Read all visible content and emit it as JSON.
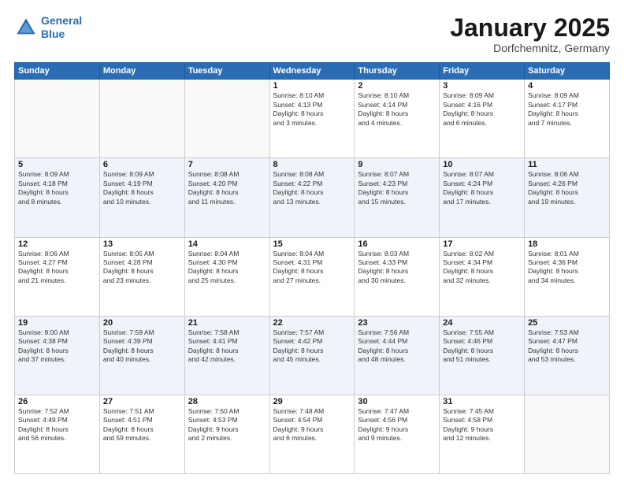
{
  "header": {
    "logo_line1": "General",
    "logo_line2": "Blue",
    "month": "January 2025",
    "location": "Dorfchemnitz, Germany"
  },
  "weekdays": [
    "Sunday",
    "Monday",
    "Tuesday",
    "Wednesday",
    "Thursday",
    "Friday",
    "Saturday"
  ],
  "weeks": [
    [
      {
        "day": "",
        "info": ""
      },
      {
        "day": "",
        "info": ""
      },
      {
        "day": "",
        "info": ""
      },
      {
        "day": "1",
        "info": "Sunrise: 8:10 AM\nSunset: 4:13 PM\nDaylight: 8 hours\nand 3 minutes."
      },
      {
        "day": "2",
        "info": "Sunrise: 8:10 AM\nSunset: 4:14 PM\nDaylight: 8 hours\nand 4 minutes."
      },
      {
        "day": "3",
        "info": "Sunrise: 8:09 AM\nSunset: 4:16 PM\nDaylight: 8 hours\nand 6 minutes."
      },
      {
        "day": "4",
        "info": "Sunrise: 8:09 AM\nSunset: 4:17 PM\nDaylight: 8 hours\nand 7 minutes."
      }
    ],
    [
      {
        "day": "5",
        "info": "Sunrise: 8:09 AM\nSunset: 4:18 PM\nDaylight: 8 hours\nand 8 minutes."
      },
      {
        "day": "6",
        "info": "Sunrise: 8:09 AM\nSunset: 4:19 PM\nDaylight: 8 hours\nand 10 minutes."
      },
      {
        "day": "7",
        "info": "Sunrise: 8:08 AM\nSunset: 4:20 PM\nDaylight: 8 hours\nand 11 minutes."
      },
      {
        "day": "8",
        "info": "Sunrise: 8:08 AM\nSunset: 4:22 PM\nDaylight: 8 hours\nand 13 minutes."
      },
      {
        "day": "9",
        "info": "Sunrise: 8:07 AM\nSunset: 4:23 PM\nDaylight: 8 hours\nand 15 minutes."
      },
      {
        "day": "10",
        "info": "Sunrise: 8:07 AM\nSunset: 4:24 PM\nDaylight: 8 hours\nand 17 minutes."
      },
      {
        "day": "11",
        "info": "Sunrise: 8:06 AM\nSunset: 4:26 PM\nDaylight: 8 hours\nand 19 minutes."
      }
    ],
    [
      {
        "day": "12",
        "info": "Sunrise: 8:06 AM\nSunset: 4:27 PM\nDaylight: 8 hours\nand 21 minutes."
      },
      {
        "day": "13",
        "info": "Sunrise: 8:05 AM\nSunset: 4:28 PM\nDaylight: 8 hours\nand 23 minutes."
      },
      {
        "day": "14",
        "info": "Sunrise: 8:04 AM\nSunset: 4:30 PM\nDaylight: 8 hours\nand 25 minutes."
      },
      {
        "day": "15",
        "info": "Sunrise: 8:04 AM\nSunset: 4:31 PM\nDaylight: 8 hours\nand 27 minutes."
      },
      {
        "day": "16",
        "info": "Sunrise: 8:03 AM\nSunset: 4:33 PM\nDaylight: 8 hours\nand 30 minutes."
      },
      {
        "day": "17",
        "info": "Sunrise: 8:02 AM\nSunset: 4:34 PM\nDaylight: 8 hours\nand 32 minutes."
      },
      {
        "day": "18",
        "info": "Sunrise: 8:01 AM\nSunset: 4:36 PM\nDaylight: 8 hours\nand 34 minutes."
      }
    ],
    [
      {
        "day": "19",
        "info": "Sunrise: 8:00 AM\nSunset: 4:38 PM\nDaylight: 8 hours\nand 37 minutes."
      },
      {
        "day": "20",
        "info": "Sunrise: 7:59 AM\nSunset: 4:39 PM\nDaylight: 8 hours\nand 40 minutes."
      },
      {
        "day": "21",
        "info": "Sunrise: 7:58 AM\nSunset: 4:41 PM\nDaylight: 8 hours\nand 42 minutes."
      },
      {
        "day": "22",
        "info": "Sunrise: 7:57 AM\nSunset: 4:42 PM\nDaylight: 8 hours\nand 45 minutes."
      },
      {
        "day": "23",
        "info": "Sunrise: 7:56 AM\nSunset: 4:44 PM\nDaylight: 8 hours\nand 48 minutes."
      },
      {
        "day": "24",
        "info": "Sunrise: 7:55 AM\nSunset: 4:46 PM\nDaylight: 8 hours\nand 51 minutes."
      },
      {
        "day": "25",
        "info": "Sunrise: 7:53 AM\nSunset: 4:47 PM\nDaylight: 8 hours\nand 53 minutes."
      }
    ],
    [
      {
        "day": "26",
        "info": "Sunrise: 7:52 AM\nSunset: 4:49 PM\nDaylight: 8 hours\nand 56 minutes."
      },
      {
        "day": "27",
        "info": "Sunrise: 7:51 AM\nSunset: 4:51 PM\nDaylight: 8 hours\nand 59 minutes."
      },
      {
        "day": "28",
        "info": "Sunrise: 7:50 AM\nSunset: 4:53 PM\nDaylight: 9 hours\nand 2 minutes."
      },
      {
        "day": "29",
        "info": "Sunrise: 7:48 AM\nSunset: 4:54 PM\nDaylight: 9 hours\nand 6 minutes."
      },
      {
        "day": "30",
        "info": "Sunrise: 7:47 AM\nSunset: 4:56 PM\nDaylight: 9 hours\nand 9 minutes."
      },
      {
        "day": "31",
        "info": "Sunrise: 7:45 AM\nSunset: 4:58 PM\nDaylight: 9 hours\nand 12 minutes."
      },
      {
        "day": "",
        "info": ""
      }
    ]
  ]
}
